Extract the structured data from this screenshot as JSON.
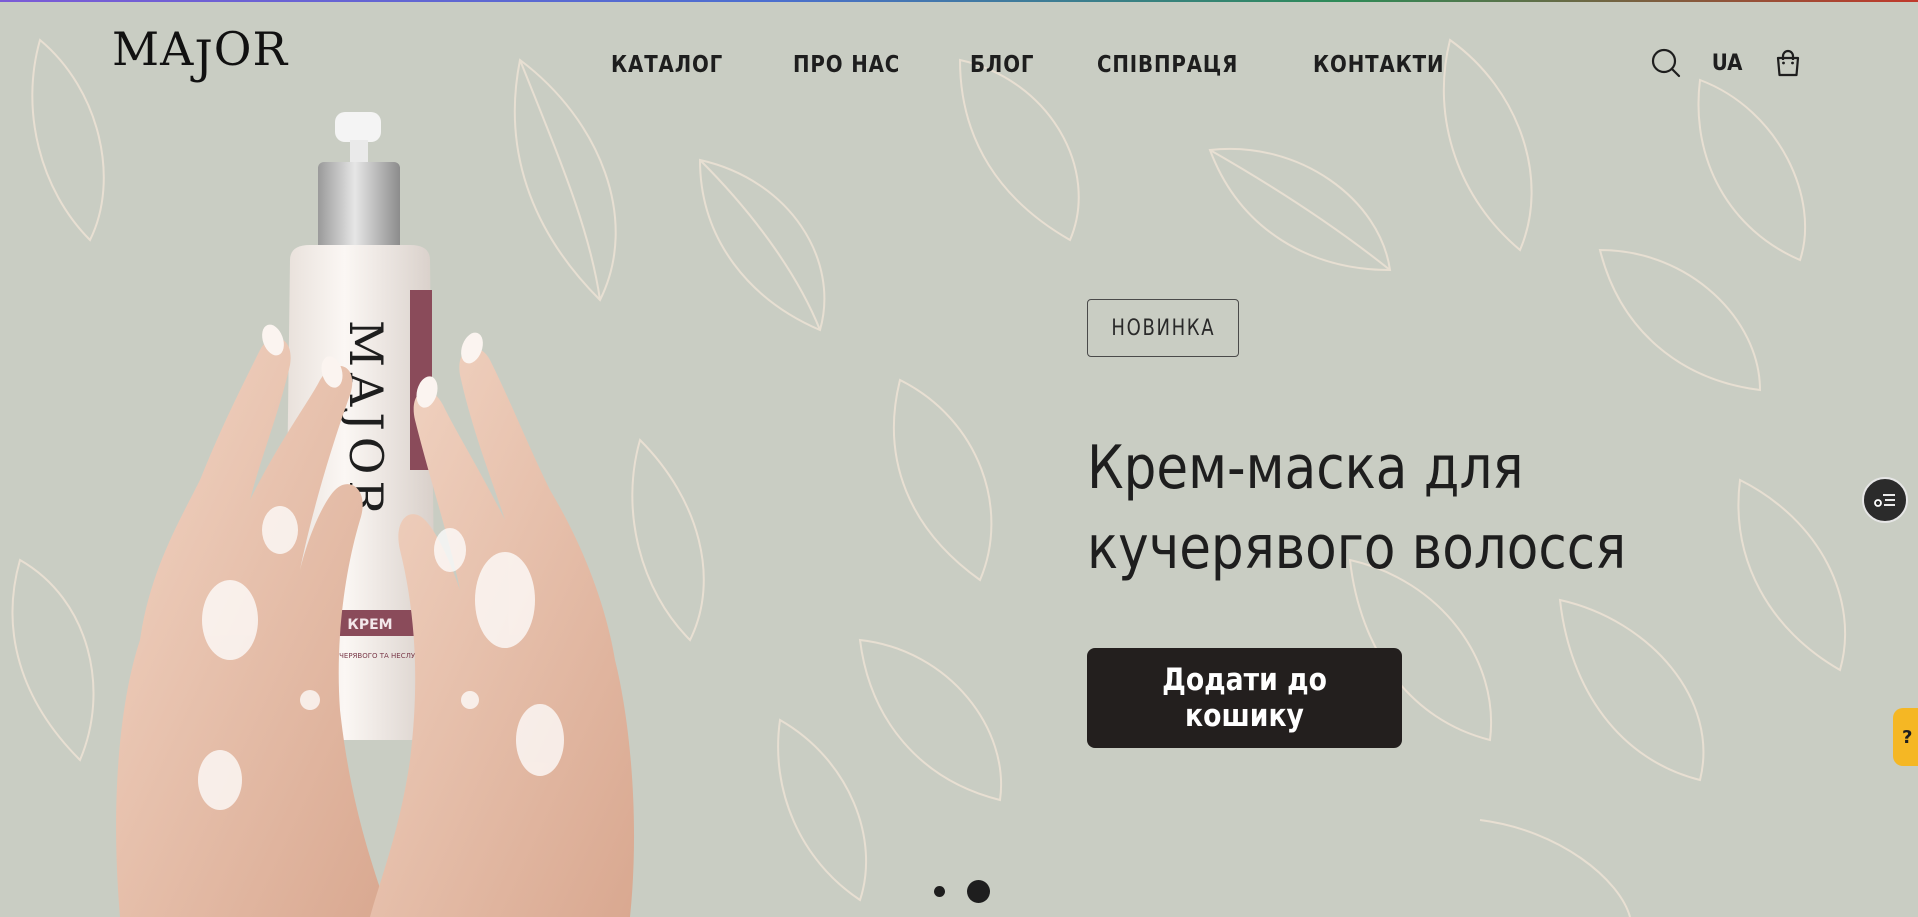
{
  "logo": {
    "text_left": "MA",
    "text_j": "J",
    "text_right": "OR"
  },
  "nav": {
    "items": [
      {
        "label": "КАТАЛОГ"
      },
      {
        "label": "ПРО НАС"
      },
      {
        "label": "БЛОГ"
      },
      {
        "label": "СПІВПРАЦЯ"
      },
      {
        "label": "КОНТАКТИ"
      }
    ]
  },
  "header": {
    "language": "UA",
    "search_icon": "search-icon",
    "cart_icon": "shopping-bag-icon"
  },
  "hero": {
    "badge": "НОВИНКА",
    "title": "Крем-маска для кучерявого волосся",
    "cta_label": "Додати до кошику",
    "slide_count": 2,
    "active_slide": 2
  },
  "product_bottle": {
    "brand": "MAJOR",
    "label_line": "КРЕМ",
    "sub_line": "ДЛЯ КУЧЕРЯВОГО ТА НЕСЛУХ"
  },
  "widgets": {
    "side_icon": "list-settings-icon",
    "help_label": "?"
  },
  "colors": {
    "background": "#c9cdc3",
    "text": "#1e1e1e",
    "cta_bg": "#231f1e",
    "help_tab": "#f5b724",
    "leaf_lines": "#e8ddd0"
  }
}
